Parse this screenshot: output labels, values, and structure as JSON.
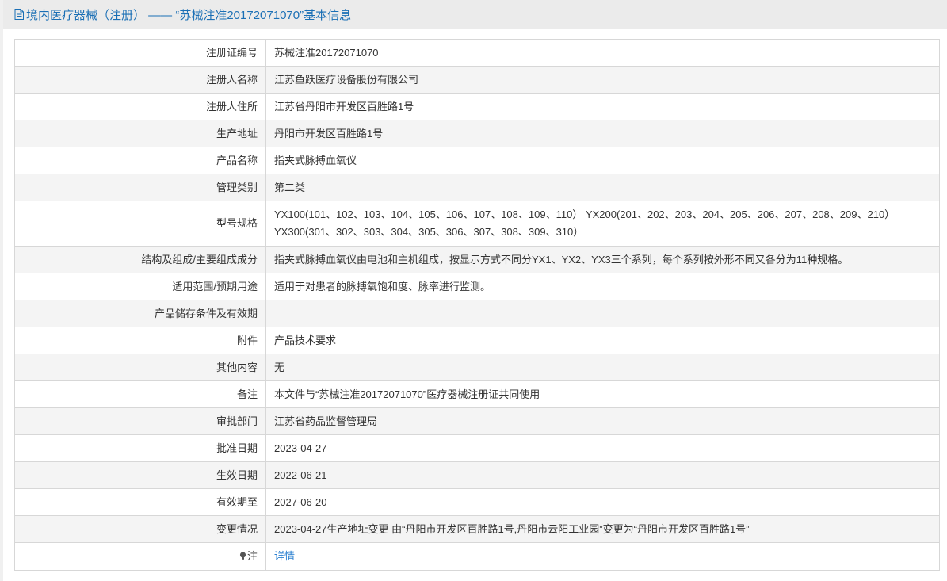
{
  "header": {
    "title": "境内医疗器械（注册） —— “苏械注准20172071070”基本信息",
    "icon": "document-icon"
  },
  "rows": [
    {
      "label": "注册证编号",
      "value": "苏械注准20172071070"
    },
    {
      "label": "注册人名称",
      "value": "江苏鱼跃医疗设备股份有限公司"
    },
    {
      "label": "注册人住所",
      "value": "江苏省丹阳市开发区百胜路1号"
    },
    {
      "label": "生产地址",
      "value": "丹阳市开发区百胜路1号"
    },
    {
      "label": "产品名称",
      "value": "指夹式脉搏血氧仪"
    },
    {
      "label": "管理类别",
      "value": "第二类"
    },
    {
      "label": "型号规格",
      "value": "YX100(101、102、103、104、105、106、107、108、109、110） YX200(201、202、203、204、205、206、207、208、209、210） YX300(301、302、303、304、305、306、307、308、309、310）"
    },
    {
      "label": "结构及组成/主要组成成分",
      "value": "指夹式脉搏血氧仪由电池和主机组成，按显示方式不同分YX1、YX2、YX3三个系列，每个系列按外形不同又各分为11种规格。"
    },
    {
      "label": "适用范围/预期用途",
      "value": "适用于对患者的脉搏氧饱和度、脉率进行监测。"
    },
    {
      "label": "产品储存条件及有效期",
      "value": ""
    },
    {
      "label": "附件",
      "value": "产品技术要求"
    },
    {
      "label": "其他内容",
      "value": "无"
    },
    {
      "label": "备注",
      "value": "本文件与“苏械注准20172071070”医疗器械注册证共同使用"
    },
    {
      "label": "审批部门",
      "value": "江苏省药品监督管理局"
    },
    {
      "label": "批准日期",
      "value": "2023-04-27"
    },
    {
      "label": "生效日期",
      "value": "2022-06-21"
    },
    {
      "label": "有效期至",
      "value": "2027-06-20"
    },
    {
      "label": "变更情况",
      "value": "2023-04-27生产地址变更 由“丹阳市开发区百胜路1号,丹阳市云阳工业园”变更为“丹阳市开发区百胜路1号”"
    }
  ],
  "note_row": {
    "label": "注",
    "link": "详情",
    "icon": "lightbulb-icon"
  },
  "colors": {
    "accent": "#1a6fb5",
    "link": "#2a7fd0",
    "row_alt": "#f4f4f4",
    "border": "#d7d7d7"
  }
}
